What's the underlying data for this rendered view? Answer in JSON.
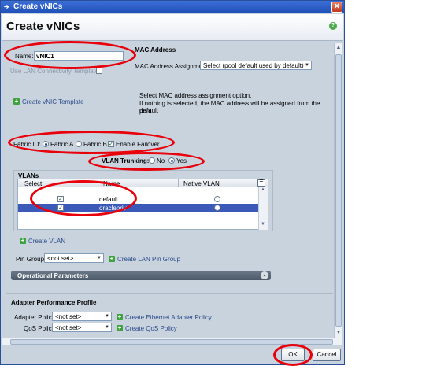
{
  "window": {
    "title": "Create vNICs",
    "close_glyph": "✕"
  },
  "header": {
    "title": "Create vNICs",
    "help_glyph": "?"
  },
  "identity": {
    "name_label": "Name:",
    "name_value": "vNIC1",
    "template_label": "Use LAN Connectivity Template:",
    "create_template_link": "Create vNIC Template"
  },
  "mac": {
    "section_title": "MAC Address",
    "assignment_label": "MAC Address Assignment:",
    "assignment_value": "Select (pool default used by default)",
    "help_text_1": "Select MAC address assignment option.",
    "help_text_2": "If nothing is selected, the MAC address will be assigned from the default",
    "help_text_3": "pool."
  },
  "fabric": {
    "label": "Fabric ID:",
    "option_a": "Fabric A",
    "option_b": "Fabric B",
    "failover_label": "Enable Failover",
    "selected": "Fabric A",
    "failover_checked": true
  },
  "vlan_trunking": {
    "label": "VLAN Trunking:",
    "no_label": "No",
    "yes_label": "Yes",
    "selected": "Yes"
  },
  "vlans": {
    "section_title": "VLANs",
    "columns": [
      "Select",
      "Name",
      "Native VLAN"
    ],
    "rows": [
      {
        "name": "default",
        "selected": true,
        "native": false
      },
      {
        "name": "oraclepriv",
        "selected": true,
        "native": false
      }
    ],
    "create_vlan_link": "Create VLAN"
  },
  "pin_group": {
    "label": "Pin Group:",
    "value": "<not set>",
    "create_link": "Create LAN Pin Group"
  },
  "operational": {
    "title": "Operational Parameters"
  },
  "adapter": {
    "section_title": "Adapter Performance Profile",
    "policy_label": "Adapter Policy:",
    "policy_value": "<not set>",
    "policy_link": "Create Ethernet Adapter Policy",
    "qos_label": "QoS Policy:",
    "qos_value": "<not set>",
    "qos_link": "Create QoS Policy"
  },
  "footer": {
    "ok_label": "OK",
    "cancel_label": "Cancel"
  },
  "colors": {
    "highlight_ring": "#e8000b",
    "selection": "#3a59b8",
    "titlebar": "#2a5cc7"
  },
  "icons": [
    "window-arrow-icon",
    "close-icon",
    "help-icon",
    "plus-icon",
    "chevron-down-icon",
    "column-chooser-icon"
  ]
}
